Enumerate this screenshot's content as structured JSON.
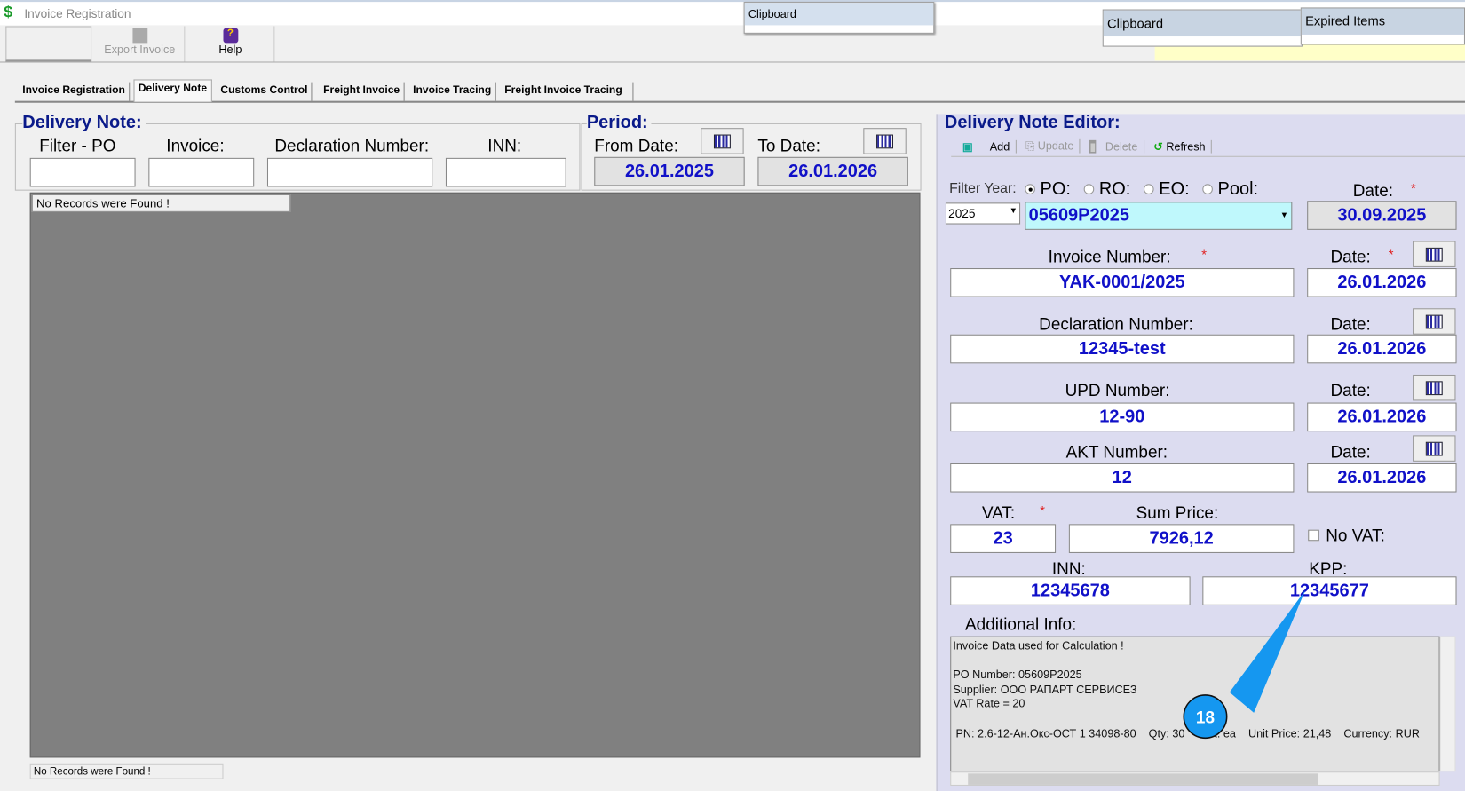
{
  "window": {
    "title": "Invoice Registration",
    "icon": "dollar-icon"
  },
  "toolbar": {
    "export_label": "Export Invoice",
    "help_label": "Help"
  },
  "popups": {
    "clipboard1": "Clipboard",
    "clipboard2": "Clipboard",
    "expired": "Expired Items"
  },
  "tabs": [
    "Invoice Registration",
    "Delivery Note",
    "Customs Control",
    "Freight Invoice",
    "Invoice Tracing",
    "Freight Invoice Tracing"
  ],
  "active_tab": "Delivery Note",
  "delivery_note": {
    "title": "Delivery Note:",
    "filter_po": "Filter - PO",
    "invoice": "Invoice:",
    "declaration": "Declaration Number:",
    "inn": "INN:",
    "grid_message": "No Records were Found !",
    "status": "No Records were Found !"
  },
  "period": {
    "title": "Period:",
    "from_label": "From Date:",
    "from_value": "26.01.2025",
    "to_label": "To Date:",
    "to_value": "26.01.2026"
  },
  "editor": {
    "title": "Delivery Note Editor:",
    "add": "Add",
    "update": "Update",
    "delete": "Delete",
    "refresh": "Refresh",
    "filter_year": "Filter Year:",
    "year": "2025",
    "po": "PO:",
    "ro": "RO:",
    "eo": "EO:",
    "pool": "Pool:",
    "selected_radio": "PO",
    "po_value": "05609P2025",
    "date_label": "Date:",
    "po_date": "30.09.2025",
    "invoice_label": "Invoice Number:",
    "invoice_value": "YAK-0001/2025",
    "invoice_date": "26.01.2026",
    "declaration_label": "Declaration Number:",
    "declaration_value": "12345-test",
    "declaration_date": "26.01.2026",
    "upd_label": "UPD Number:",
    "upd_value": "12-90",
    "upd_date": "26.01.2026",
    "akt_label": "AKT Number:",
    "akt_value": "12",
    "akt_date": "26.01.2026",
    "vat_label": "VAT:",
    "vat_value": "23",
    "sum_label": "Sum Price:",
    "sum_value": "7926,12",
    "novat_label": "No VAT:",
    "novat_checked": false,
    "inn_label": "INN:",
    "inn_value": "12345678",
    "kpp_label": "KPP:",
    "kpp_value": "12345677",
    "additional_label": "Additional Info:",
    "info_lines": [
      "Invoice Data used for Calculation !",
      "",
      "PO Number: 05609P2025",
      "Supplier: ООО РАПАРТ СЕРВИСЕЗ",
      "VAT Rate = 20"
    ],
    "info_item": "PN: 2.6-12-Ан.Окс-ОСТ 1 34098-80    Qty: 30    Unit: ea    Unit Price: 21,48    Currency: RUR"
  },
  "annotation": {
    "number": "18",
    "color": "#1597f0"
  }
}
